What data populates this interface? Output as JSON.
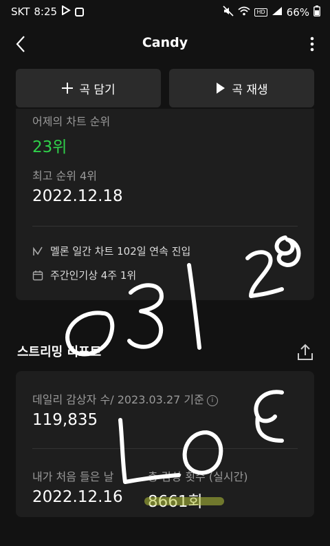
{
  "status_bar": {
    "carrier": "SKT",
    "time": "8:25",
    "hd_label": "HD",
    "battery": "66%"
  },
  "app_bar": {
    "title": "Candy"
  },
  "actions": {
    "add_label": "곡 담기",
    "play_label": "곡 재생"
  },
  "chart_info": {
    "yesterday_rank_label": "어제의 차트 순위",
    "yesterday_rank_value": "23위",
    "best_rank_label": "최고 순위 4위",
    "best_rank_date": "2022.12.18",
    "features": [
      {
        "icon": "trend-icon",
        "text": "멜론 일간 차트 102일 연속 진입"
      },
      {
        "icon": "calendar-icon",
        "text": "주간인기상 4주 1위"
      }
    ]
  },
  "streaming_report": {
    "title": "스트리밍 리포트",
    "daily_listeners_label": "데일리 감상자 수/ 2023.03.27 기준",
    "daily_listeners_value": "119,835",
    "first_listen_label": "내가 처음 들은 날",
    "first_listen_value": "2022.12.16",
    "total_plays_label": "총 감상 횟수 (실시간)",
    "total_plays_value": "8661회"
  },
  "colors": {
    "background": "#121212",
    "card": "#1e1e1e",
    "button": "#2b2b2b",
    "rank_green": "#2fd24a",
    "highlight": "#b4c23a"
  }
}
